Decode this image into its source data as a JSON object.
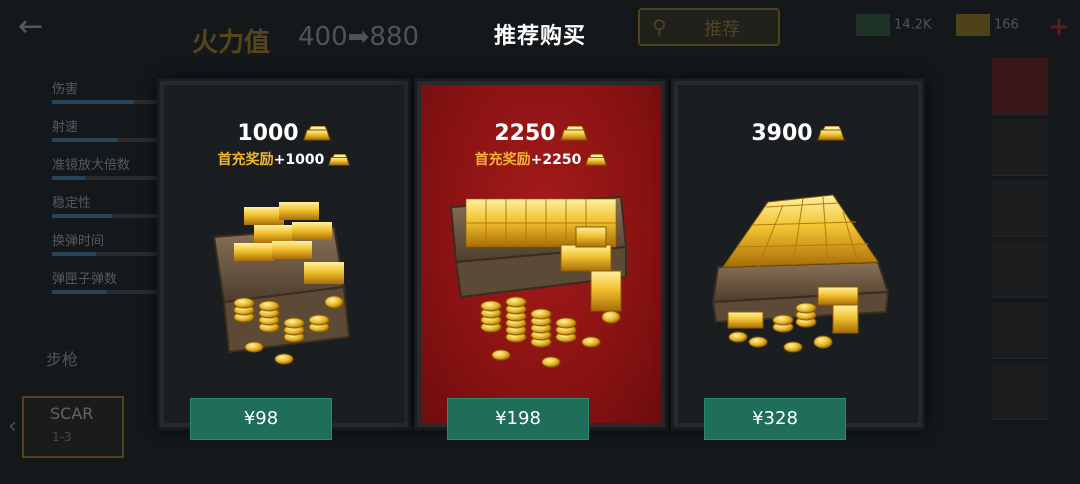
{
  "background": {
    "back_icon": "back-arrow-icon",
    "firepower_label": "火力值",
    "firepower_range": "400➡880",
    "search_label": "推荐",
    "cash_amount": "14.2K",
    "gold_amount": "166",
    "stats": [
      {
        "label": "伤害",
        "fill": 0.75
      },
      {
        "label": "射速",
        "fill": 0.6
      },
      {
        "label": "准镜放大倍数",
        "fill": 0.3
      },
      {
        "label": "稳定性",
        "fill": 0.55
      },
      {
        "label": "换弹时间",
        "fill": 0.4
      },
      {
        "label": "弹匣子弹数",
        "fill": 0.5
      }
    ],
    "category_label": "步枪",
    "selected_weapon": {
      "name": "SCAR",
      "sub": "1-3"
    }
  },
  "title": "推荐购买",
  "offers": [
    {
      "amount": "1000",
      "bonus_label": "首充奖励",
      "bonus_value": "+1000",
      "price": "¥98",
      "featured": false
    },
    {
      "amount": "2250",
      "bonus_label": "首充奖励",
      "bonus_value": "+2250",
      "price": "¥198",
      "featured": true
    },
    {
      "amount": "3900",
      "bonus_label": "",
      "bonus_value": "",
      "price": "¥328",
      "featured": false
    }
  ],
  "colors": {
    "gold_text": "#f0b430",
    "featured_bg": "#8c1313",
    "price_button": "#1f6e5a"
  }
}
